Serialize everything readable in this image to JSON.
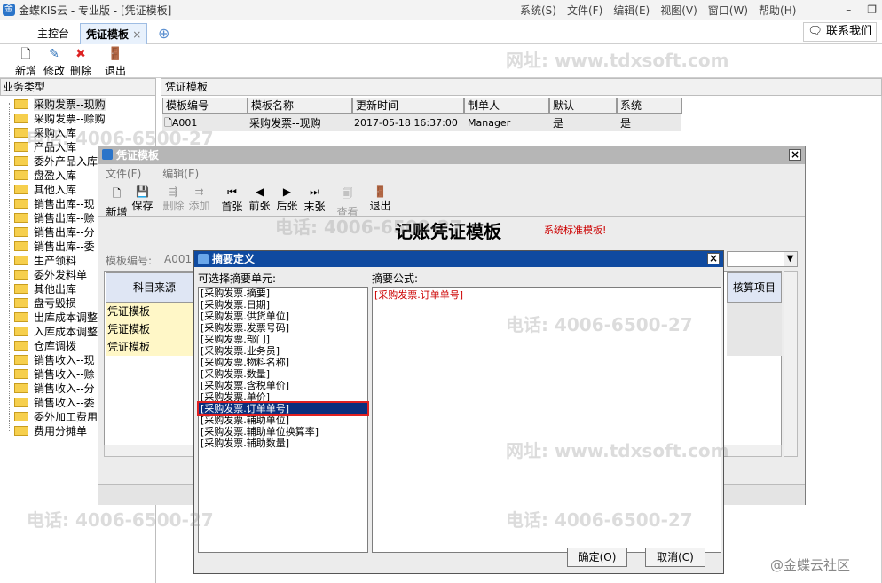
{
  "app": {
    "title": "金蝶KIS云 - 专业版 - [凭证模板]",
    "logo": "金"
  },
  "menus": [
    "系统(S)",
    "文件(F)",
    "编辑(E)",
    "视图(V)",
    "窗口(W)",
    "帮助(H)"
  ],
  "tabs": [
    "主控台",
    "凭证模板"
  ],
  "contact": "联系我们",
  "toolbar": [
    "新增",
    "修改",
    "删除",
    "退出"
  ],
  "left_header": "业务类型",
  "tree": [
    "采购发票--现购",
    "采购发票--赊购",
    "采购入库",
    "产品入库",
    "委外产品入库",
    "盘盈入库",
    "其他入库",
    "销售出库--现",
    "销售出库--赊",
    "销售出库--分",
    "销售出库--委",
    "生产领料",
    "委外发料单",
    "其他出库",
    "盘亏毁损",
    "出库成本调整",
    "入库成本调整",
    "仓库调拨",
    "销售收入--现",
    "销售收入--赊",
    "销售收入--分",
    "销售收入--委",
    "委外加工费用",
    "费用分摊单"
  ],
  "right_header": "凭证模板",
  "grid": {
    "columns": [
      "模板编号",
      "模板名称",
      "更新时间",
      "制单人",
      "默认",
      "系统"
    ],
    "row": [
      "A001",
      "采购发票--现购",
      "2017-05-18 16:37:00",
      "Manager",
      "是",
      "是"
    ]
  },
  "watermark": {
    "tel": "电话: 4006-6500-27",
    "web": "网址: www.tdxsoft.com"
  },
  "dialog": {
    "title": "凭证模板",
    "menus": [
      "文件(F)",
      "编辑(E)"
    ],
    "toolbar": [
      "新增",
      "保存",
      "删除",
      "添加",
      "首张",
      "前张",
      "后张",
      "末张",
      "查看",
      "退出"
    ],
    "heading": "记账凭证模板",
    "subtitle": "系统标准模板!",
    "template_no_label": "模板编号:",
    "template_no": "A001",
    "col_source": "科目来源",
    "col_check": "核算项目",
    "rows": [
      "凭证模板",
      "凭证模板",
      "凭证模板"
    ]
  },
  "modal": {
    "title": "摘要定义",
    "left_label": "可选择摘要单元:",
    "right_label": "摘要公式:",
    "items": [
      "[采购发票.摘要]",
      "[采购发票.日期]",
      "[采购发票.供货单位]",
      "[采购发票.发票号码]",
      "[采购发票.部门]",
      "[采购发票.业务员]",
      "[采购发票.物料名称]",
      "[采购发票.数量]",
      "[采购发票.含税单价]",
      "[采购发票.单价]",
      "[采购发票.订单单号]",
      "[采购发票.辅助单位]",
      "[采购发票.辅助单位换算率]",
      "[采购发票.辅助数量]"
    ],
    "formula": "[采购发票.订单单号]",
    "ok": "确定(O)",
    "cancel": "取消(C)"
  },
  "footer_brand": "@金蝶云社区"
}
